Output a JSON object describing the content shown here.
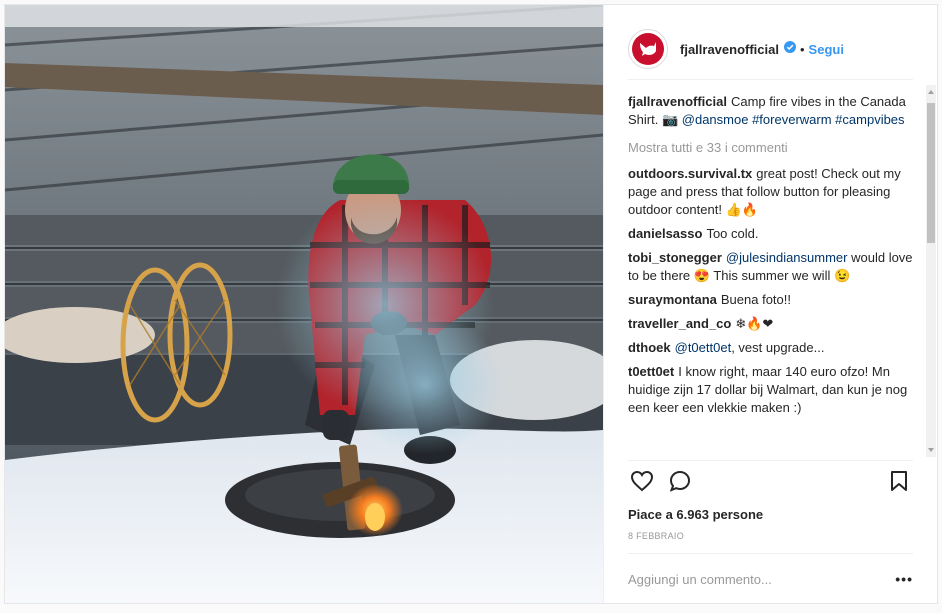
{
  "header": {
    "username": "fjallravenofficial",
    "separator": "•",
    "follow_label": "Segui",
    "icons": {
      "avatar": "fox-logo",
      "verified": "verified-badge-icon"
    }
  },
  "caption": {
    "user": "fjallravenofficial",
    "text": "Camp fire vibes in the Canada Shirt. 📷",
    "mention": "@dansmoe",
    "tag1": "#foreverwarm",
    "tag2": "#campvibes"
  },
  "show_all": "Mostra tutti e 33 i commenti",
  "comments": [
    {
      "user": "outdoors.survival.tx",
      "text": "great post! Check out my page and press that follow button for pleasing outdoor content! 👍🔥"
    },
    {
      "user": "danielsasso",
      "text": "Too cold."
    },
    {
      "user": "tobi_stonegger",
      "mention": "@julesindiansummer",
      "text": "would love to be there 😍 This summer we will 😉"
    },
    {
      "user": "suraymontana",
      "text": "Buena foto!!"
    },
    {
      "user": "traveller_and_co",
      "text": "❄🔥❤"
    },
    {
      "user": "dthoek",
      "mention": "@t0ett0et",
      "text": ", vest upgrade..."
    },
    {
      "user": "t0ett0et",
      "text": "I know right, maar 140 euro ofzo! Mn huidige zijn 17 dollar bij Walmart, dan kun je nog een keer een vlekkie maken :)"
    }
  ],
  "likes": "Piace a 6.963 persone",
  "date": "8 FEBBRAIO",
  "add_comment": {
    "placeholder": "Aggiungi un commento..."
  },
  "more_options": "•••",
  "colors": {
    "accent": "#3897f0",
    "link": "#003569",
    "brand": "#c8102e",
    "text": "#262626",
    "muted": "#999999"
  }
}
